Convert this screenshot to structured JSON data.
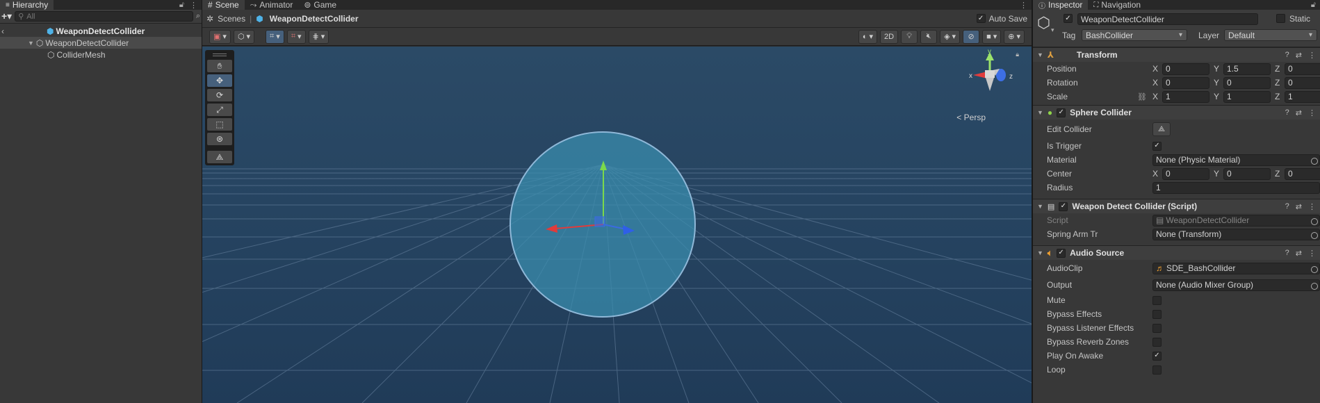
{
  "hierarchy": {
    "tab_label": "Hierarchy",
    "search_placeholder": "All",
    "root": "WeaponDetectCollider",
    "items": [
      {
        "label": "WeaponDetectCollider"
      },
      {
        "label": "ColliderMesh"
      }
    ]
  },
  "tabs": [
    {
      "label": "Scene"
    },
    {
      "label": "Animator"
    },
    {
      "label": "Game"
    }
  ],
  "scene": {
    "breadcrumb_root": "Scenes",
    "breadcrumb_current": "WeaponDetectCollider",
    "autosave_label": "Auto Save",
    "mode_2d_label": "2D",
    "persp_label": "Persp",
    "gizmo_labels": {
      "x": "x",
      "y": "y",
      "z": "z"
    }
  },
  "inspector": {
    "tab_label": "Inspector",
    "nav_tab_label": "Navigation",
    "object_name": "WeaponDetectCollider",
    "static_label": "Static",
    "tag_label": "Tag",
    "tag_value": "BashCollider",
    "layer_label": "Layer",
    "layer_value": "Default",
    "transform": {
      "title": "Transform",
      "position_label": "Position",
      "rotation_label": "Rotation",
      "scale_label": "Scale",
      "position": {
        "x": "0",
        "y": "1.5",
        "z": "0"
      },
      "rotation": {
        "x": "0",
        "y": "0",
        "z": "0"
      },
      "scale": {
        "x": "1",
        "y": "1",
        "z": "1"
      }
    },
    "sphere_collider": {
      "title": "Sphere Collider",
      "edit_label": "Edit Collider",
      "trigger_label": "Is Trigger",
      "material_label": "Material",
      "material_value": "None (Physic Material)",
      "center_label": "Center",
      "center": {
        "x": "0",
        "y": "0",
        "z": "0"
      },
      "radius_label": "Radius",
      "radius_value": "1"
    },
    "script": {
      "title": "Weapon Detect Collider (Script)",
      "script_label": "Script",
      "script_value": "WeaponDetectCollider",
      "spring_label": "Spring Arm Tr",
      "spring_value": "None (Transform)"
    },
    "audio": {
      "title": "Audio Source",
      "clip_label": "AudioClip",
      "clip_value": "SDE_BashCollider",
      "output_label": "Output",
      "output_value": "None (Audio Mixer Group)",
      "mute_label": "Mute",
      "bypass_label": "Bypass Effects",
      "bypass_listener_label": "Bypass Listener Effects",
      "bypass_reverb_label": "Bypass Reverb Zones",
      "play_label": "Play On Awake",
      "loop_label": "Loop"
    },
    "axis_labels": {
      "x": "X",
      "y": "Y",
      "z": "Z"
    }
  }
}
